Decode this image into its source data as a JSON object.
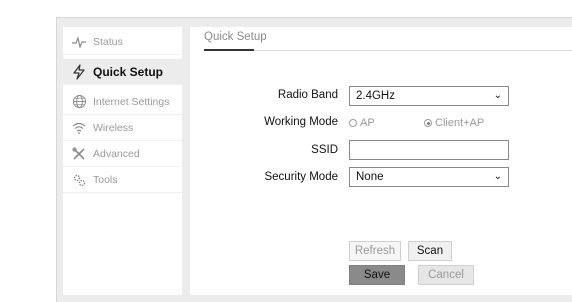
{
  "sidebar": {
    "items": [
      {
        "label": "Status",
        "icon": "pulse-icon"
      },
      {
        "label": "Quick Setup",
        "icon": "lightning-icon"
      },
      {
        "label": "Internet Settings",
        "icon": "globe-icon"
      },
      {
        "label": "Wireless",
        "icon": "wifi-icon"
      },
      {
        "label": "Advanced",
        "icon": "tools-cross-icon"
      },
      {
        "label": "Tools",
        "icon": "gears-icon"
      }
    ],
    "active": "Quick Setup"
  },
  "main": {
    "tab": "Quick Setup",
    "radio_band": {
      "label": "Radio Band",
      "value": "2.4GHz"
    },
    "working_mode": {
      "label": "Working Mode",
      "options": [
        {
          "label": "AP",
          "selected": false
        },
        {
          "label": "Client+AP",
          "selected": true
        }
      ]
    },
    "ssid": {
      "label": "SSID",
      "value": ""
    },
    "security_mode": {
      "label": "Security Mode",
      "value": "None"
    },
    "buttons": {
      "refresh": "Refresh",
      "scan": "Scan",
      "save": "Save",
      "cancel": "Cancel"
    }
  },
  "colors": {
    "background": "#ececec",
    "panel": "#ffffff",
    "save_button": "#8a8a8a",
    "muted_text": "#9a9a9a"
  }
}
